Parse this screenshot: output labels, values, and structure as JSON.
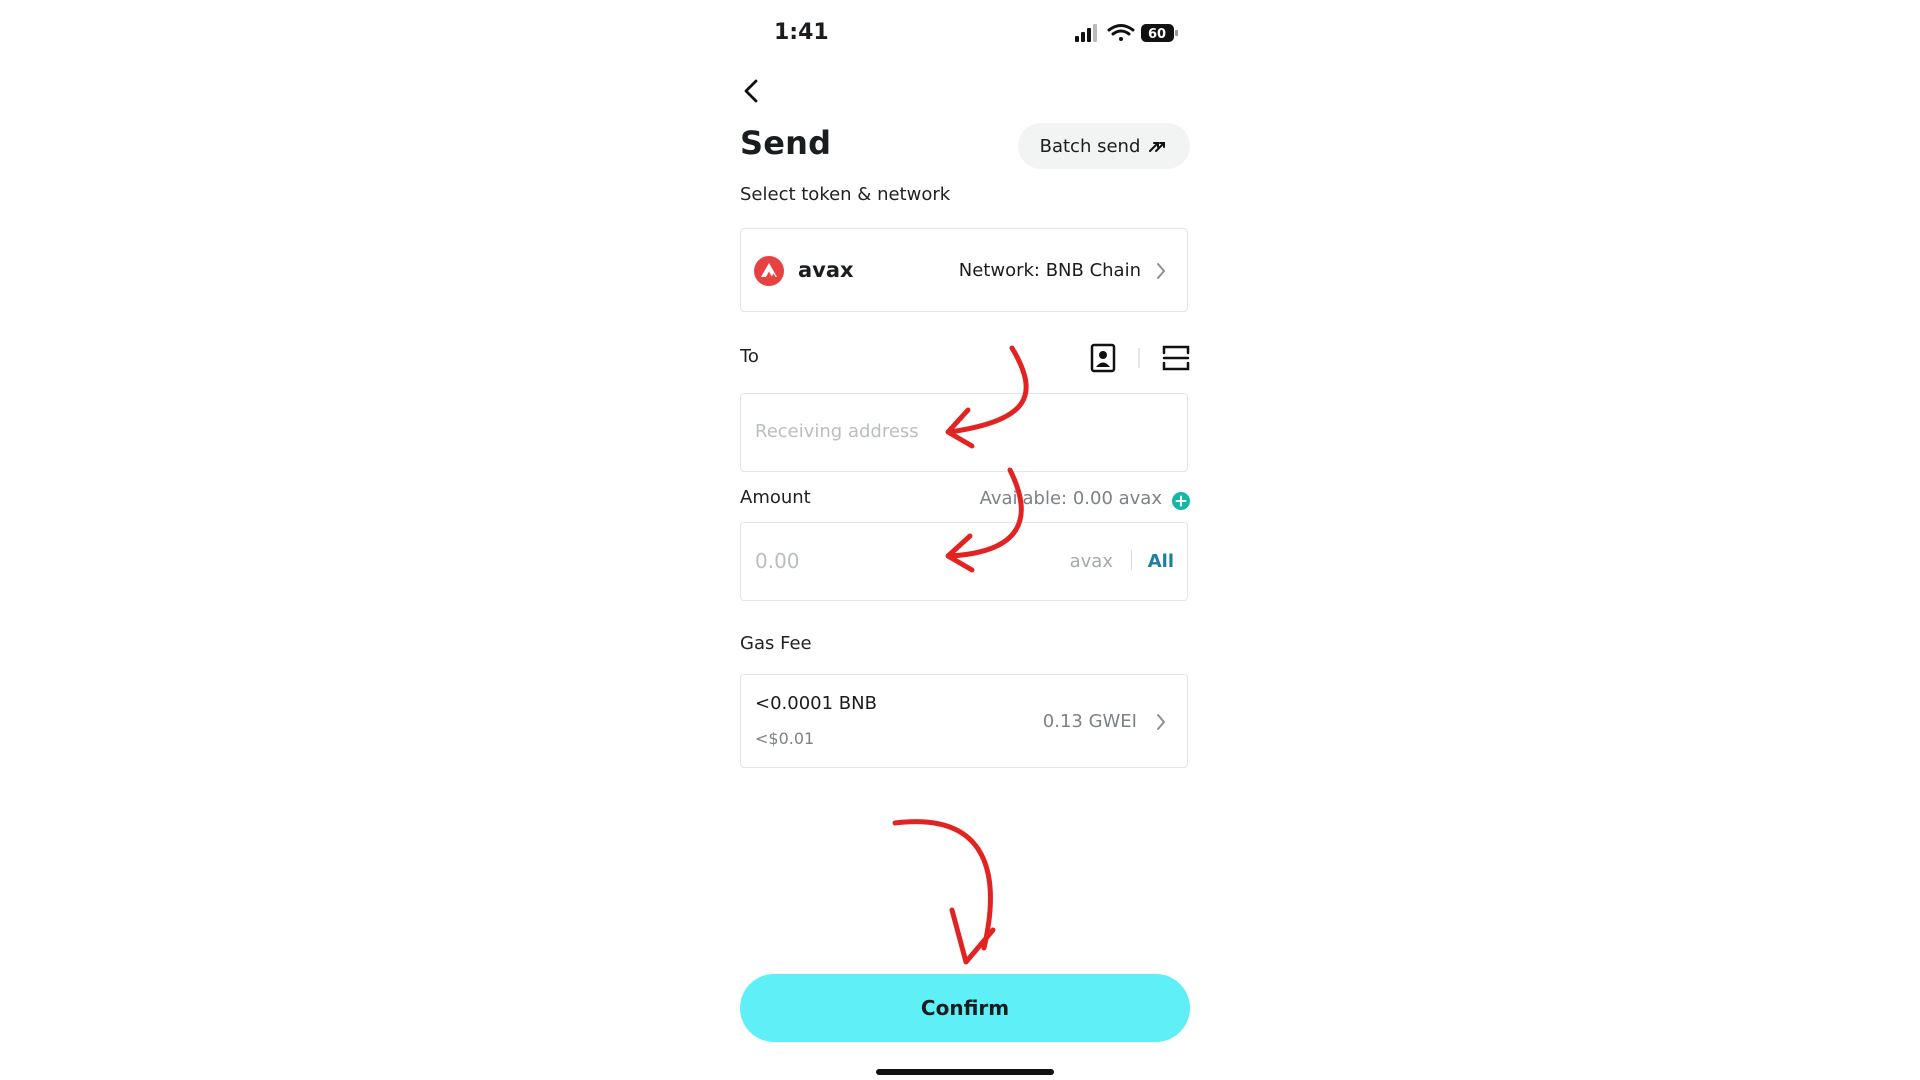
{
  "status_bar": {
    "time": "1:41",
    "battery": "60"
  },
  "header": {
    "title": "Send",
    "batch_send_label": "Batch send"
  },
  "token_section": {
    "label": "Select token & network",
    "token_name": "avax",
    "network_label": "Network: BNB Chain"
  },
  "to_section": {
    "label": "To",
    "address_placeholder": "Receiving address"
  },
  "amount_section": {
    "label": "Amount",
    "available": "Available: 0.00 avax",
    "amount_placeholder": "0.00",
    "unit": "avax",
    "all_label": "All"
  },
  "gas_section": {
    "label": "Gas Fee",
    "fee_bnb": "<0.0001 BNB",
    "fee_usd": "<$0.01",
    "gwei": "0.13 GWEI"
  },
  "confirm_label": "Confirm",
  "colors": {
    "accent": "#5ff0f7",
    "avax_red": "#e84142",
    "plus_teal": "#14b8a6",
    "annotation_red": "#e32322"
  }
}
